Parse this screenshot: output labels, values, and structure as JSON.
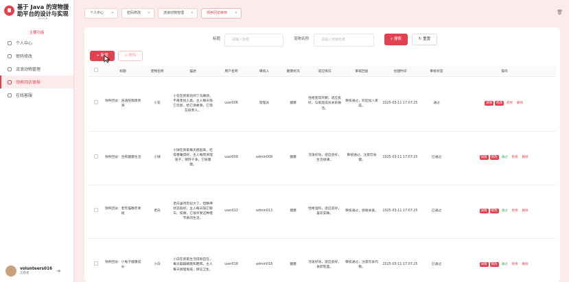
{
  "app": {
    "title_line1": "基于 Java 的宠物援",
    "title_line2": "助平台的设计与实现",
    "admin_badge": "ADMIN"
  },
  "sidebar": {
    "header": "主要功能",
    "items": [
      {
        "label": "个人中心",
        "icon": "user-icon"
      },
      {
        "label": "密码修改",
        "icon": "key-icon"
      },
      {
        "label": "流浪动物管理",
        "icon": "pet-icon"
      },
      {
        "label": "领养回访审核",
        "icon": "review-icon"
      },
      {
        "label": "在线客服",
        "icon": "chat-icon"
      }
    ],
    "user": {
      "name": "volunteers016",
      "role": "志愿者"
    }
  },
  "tabs": [
    {
      "label": "个人中心"
    },
    {
      "label": "密码修改"
    },
    {
      "label": "流浪动物管理"
    },
    {
      "label": "领养回访审核"
    }
  ],
  "filters": {
    "title_label": "标题",
    "title_placeholder": "请输入标题",
    "pet_label": "宠物名称",
    "pet_placeholder": "请输入宠物名称"
  },
  "buttons": {
    "search": "搜索",
    "reset": "重置",
    "add": "新增",
    "delete": "删除"
  },
  "table": {
    "columns": [
      "标题",
      "宠物名称",
      "描述",
      "用户名称",
      "审核人",
      "健康状况",
      "适应情况",
      "审核回复",
      "创建时间",
      "审核状态",
      "操作"
    ],
    "actions": {
      "detail": "详情",
      "edit": "修改",
      "pass": "通过",
      "reject": "拒绝",
      "del": "删除"
    },
    "rows": [
      {
        "title": "领养回访：浩浩陪我跑到滑",
        "pet": "小花",
        "desc": "小花在新家找到了归属感，不再害怕人类。主人每天陪它玩耍，给它讲故事，它现在很亲人。",
        "user": "user006",
        "reviewer": "管理员",
        "health": "健康",
        "adapt": "性格变得开朗，适应良好，与家庭成员关系融洽。",
        "reply": "审核通过，欢迎加入家庭。",
        "created": "2025-03-11 17:07:25",
        "status": "通过"
      },
      {
        "title": "领养回访：合照健康生活",
        "pet": "小球",
        "desc": "小球在新家每天跑起来，吃得香睡得好。主人每周清理笼子，保持干净，它很健康。",
        "user": "user009",
        "reviewer": "admin009",
        "health": "健康",
        "adapt": "活泼好动，适应良好，生活规律。",
        "reply": "审核通过，注意饮食健。",
        "created": "2025-03-11 17:07:25",
        "status": "已通过"
      },
      {
        "title": "领养回访：老年猫晚年幸福",
        "pet": "老白",
        "desc": "老白虽然年纪大了，但精神状态很好。主人每天陪它聊天、按摩，它很享受这种慢节奏的生活。",
        "user": "user013",
        "reviewer": "admin013",
        "health": "健康",
        "adapt": "性格温和，适应良好，喜欢安静。",
        "reply": "审核通过，感谢关爱。",
        "created": "2025-03-11 17:07:25",
        "status": "已通过"
      },
      {
        "title": "领养回访：小兔子健康成长",
        "pet": "小白",
        "desc": "小白在新家生活得很自在，每天蹦蹦跳跳和晒草。主人每天搞理兔笼，保证卫生。",
        "user": "user018",
        "reviewer": "admin018",
        "health": "健康",
        "adapt": "活泼好动，适应良好，食欲旺盛。",
        "reply": "审核通过，注意饮食均衡。",
        "created": "2025-03-11 17:07:25",
        "status": "已通过"
      }
    ]
  },
  "colors": {
    "accent": "#e0434f",
    "background": "#fdeaea",
    "pass": "#3aa55a"
  }
}
